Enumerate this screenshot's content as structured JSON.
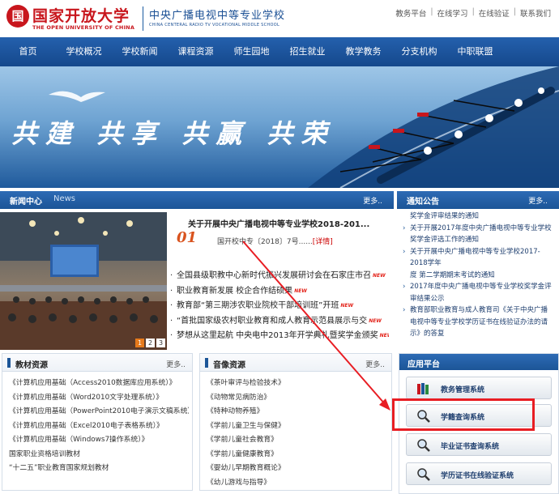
{
  "header": {
    "logo_mark": "国",
    "university_cn": "国家开放大学",
    "university_en": "THE OPEN UNIVERSITY OF CHINA",
    "school_cn": "中央广播电视中等专业学校",
    "school_en": "CHINA CENTERAL RADIO TV VOCATIONAL MIDDLE SCHOOL",
    "top_links": [
      "教务平台",
      "在线学习",
      "在线验证",
      "联系我们"
    ]
  },
  "nav": [
    "首页",
    "学校概况",
    "学校新闻",
    "课程资源",
    "师生园地",
    "招生就业",
    "教学教务",
    "分支机构",
    "中职联盟"
  ],
  "banner": {
    "slogan": "共建 共享 共赢 共荣"
  },
  "news": {
    "title_cn": "新闻中心",
    "title_en": "News",
    "more": "更多..",
    "pages": [
      "1",
      "2",
      "3"
    ],
    "featured": {
      "title": "关于开展中央广播电视中等专业学校2018-201...",
      "date_num": "01",
      "date_small": "-----",
      "subtitle": "国开校中专〔2018〕7号......",
      "detail": "[详情]"
    },
    "items": [
      {
        "text": "全国县级职教中心新时代振兴发展研讨会在石家庄市召",
        "new": true
      },
      {
        "text": "职业教育新发展 校企合作结硕果",
        "new": true
      },
      {
        "text": "教育部“第三期涉农职业院校干部培训班”开班",
        "new": true
      },
      {
        "text": "“首批国家级农村职业教育和成人教育示范县展示与交",
        "new": true
      },
      {
        "text": "梦想从这里起航 中央电中2013年开学典礼暨奖学金颁奖",
        "new": true
      }
    ],
    "new_label": "NEW"
  },
  "notice": {
    "title": "通知公告",
    "more": "更多..",
    "lines": [
      {
        "text": "奖学金评审结果的通知",
        "bullet": false
      },
      {
        "text": "关于开展2017年度中央广播电视中等专业学校",
        "bullet": true
      },
      {
        "text": "奖学金评选工作的通知",
        "bullet": false
      },
      {
        "text": "关于开展中央广播电视中等专业学校2017-2018学年",
        "bullet": true
      },
      {
        "text": "度 第二学期期末考试的通知",
        "bullet": false
      },
      {
        "text": "2017年度中央广播电视中等专业学校奖学金评",
        "bullet": true
      },
      {
        "text": "审结果公示",
        "bullet": false
      },
      {
        "text": "教育部职业教育与成人教育司《关于中央广播",
        "bullet": true
      },
      {
        "text": "电视中等专业学校学历证书在线验证办法的请",
        "bullet": false
      },
      {
        "text": "示》的答复",
        "bullet": false
      }
    ]
  },
  "materials": {
    "title": "教材资源",
    "more": "更多..",
    "items": [
      "《计算机应用基础（Access2010数据库应用系统）》",
      "《计算机应用基础（Word2010文字处理系统）》",
      "《计算机应用基础（PowerPoint2010电子演示文稿系统）》",
      "《计算机应用基础（Excel2010电子表格系统）》",
      "《计算机应用基础（Windows7操作系统）》",
      "国家职业资格培训教材",
      "“十二五”职业教育国家规划教材"
    ]
  },
  "audio": {
    "title": "音像资源",
    "more": "更多..",
    "items": [
      "《茶叶审评与检验技术》",
      "《动物常见病防治》",
      "《特种动物养殖》",
      "《学前儿童卫生与保健》",
      "《学前儿童社会教育》",
      "《学前儿童健康教育》",
      "《婴幼儿早期教育概论》",
      "《幼儿游戏与指导》"
    ]
  },
  "platform": {
    "title": "应用平台",
    "buttons": [
      "教务管理系统",
      "学籍查询系统",
      "毕业证书查询系统",
      "学历证书在线验证系统"
    ]
  },
  "colors": {
    "brand_red": "#c8161d",
    "nav_blue": "#1c5597",
    "highlight_red": "#e81d23"
  }
}
